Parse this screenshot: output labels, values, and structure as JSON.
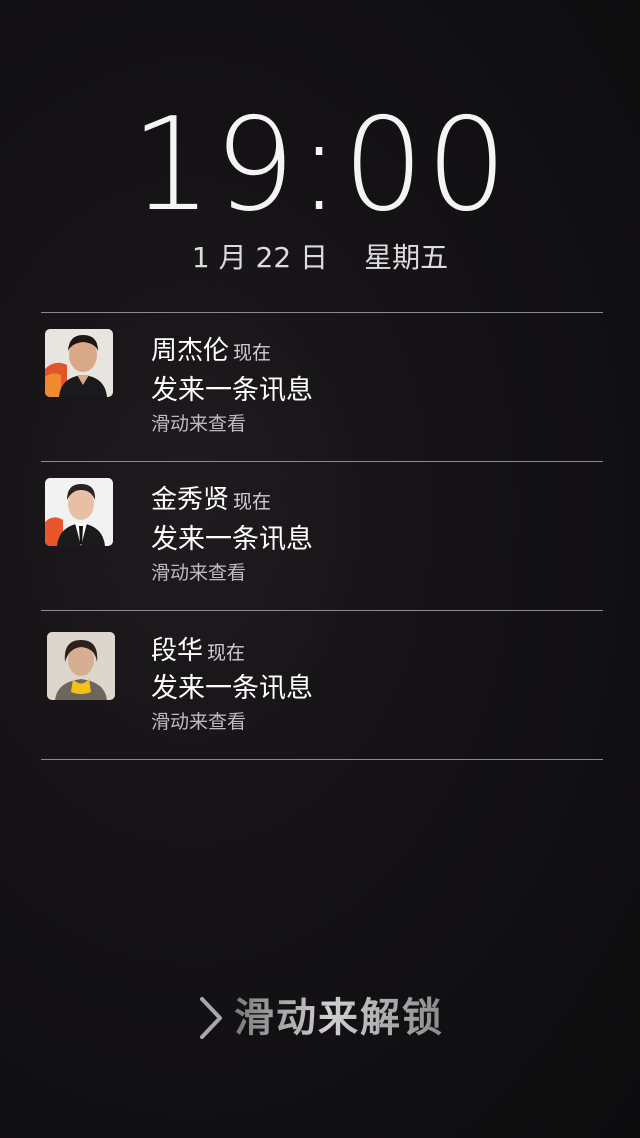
{
  "lockscreen": {
    "time": "19:00",
    "date": "1 月 22 日",
    "weekday": "星期五"
  },
  "notifications": [
    {
      "sender": "周杰伦",
      "time": "现在",
      "message": "发来一条讯息",
      "hint": "滑动来查看",
      "avatar_icon": "contact-photo"
    },
    {
      "sender": "金秀贤",
      "time": "现在",
      "message": "发来一条讯息",
      "hint": "滑动来查看",
      "avatar_icon": "contact-photo"
    },
    {
      "sender": "段华",
      "time": "现在",
      "message": "发来一条讯息",
      "hint": "滑动来查看",
      "avatar_icon": "contact-photo"
    }
  ],
  "unlock": {
    "label": "滑动来解锁",
    "icon": "chevron-right-icon"
  },
  "colors": {
    "background": "#141215",
    "divider": "#8a8a8a",
    "text_primary": "#ffffff",
    "text_secondary": "#bdbdbd"
  }
}
